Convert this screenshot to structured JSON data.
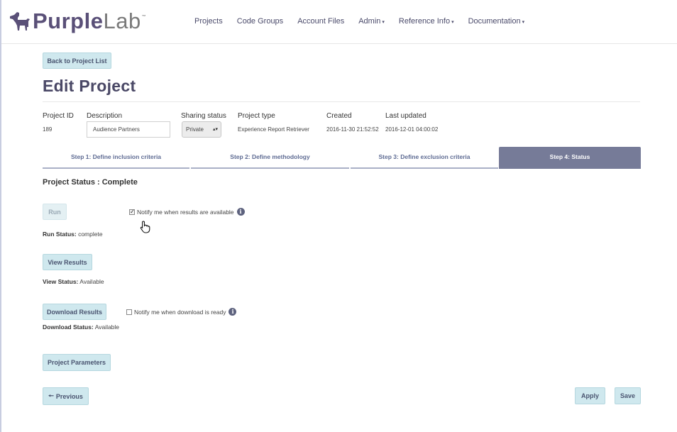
{
  "brand": {
    "purple": "Purple",
    "lab": "Lab",
    "tm": "™",
    "logo_icon": "dog-icon"
  },
  "nav": [
    {
      "label": "Projects",
      "caret": ""
    },
    {
      "label": "Code Groups",
      "caret": ""
    },
    {
      "label": "Account Files",
      "caret": ""
    },
    {
      "label": "Admin",
      "caret": "▾"
    },
    {
      "label": "Reference Info",
      "caret": "▾"
    },
    {
      "label": "Documentation",
      "caret": "▾"
    }
  ],
  "back_button": "Back to Project List",
  "page_title": "Edit Project",
  "project": {
    "id_label": "Project ID",
    "id_value": "189",
    "description_label": "Description",
    "description_value": "Audience Partners",
    "sharing_label": "Sharing status",
    "sharing_value": "Private",
    "type_label": "Project type",
    "type_value": "Experience Report Retriever",
    "created_label": "Created",
    "created_value": "2016-11-30 21:52:52",
    "updated_label": "Last updated",
    "updated_value": "2016-12-01 04:00:02"
  },
  "tabs": [
    {
      "label": "Step 1: Define inclusion criteria",
      "active": false
    },
    {
      "label": "Step 2: Define methodology",
      "active": false
    },
    {
      "label": "Step 3: Define exclusion criteria",
      "active": false
    },
    {
      "label": "Step 4: Status",
      "active": true
    }
  ],
  "status": {
    "heading": "Project Status : Complete",
    "run_button": "Run",
    "notify_results": "Notify me when results are available",
    "notify_results_checked": true,
    "run_status_label": "Run Status:",
    "run_status_value": "complete",
    "view_results_button": "View Results",
    "view_status_label": "View Status:",
    "view_status_value": "Available",
    "download_results_button": "Download Results",
    "notify_download": "Notify me when download is ready",
    "notify_download_checked": false,
    "download_status_label": "Download Status:",
    "download_status_value": "Available",
    "parameters_button": "Project Parameters"
  },
  "footer": {
    "previous_icon": "arrow-left-icon",
    "previous_button": "Previous",
    "apply_button": "Apply",
    "save_button": "Save"
  },
  "colors": {
    "brand": "#5a5078",
    "button_bg": "#cfe8ee",
    "active_tab": "#767b98",
    "tab_text": "#5d6a92"
  }
}
